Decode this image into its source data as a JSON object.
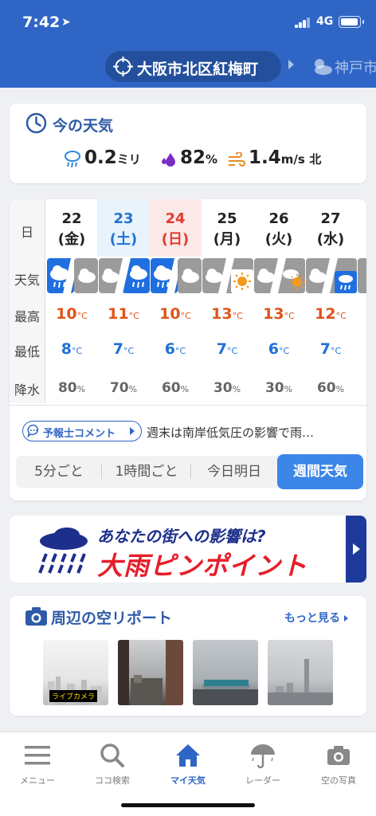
{
  "status": {
    "time": "7:42",
    "network": "4G"
  },
  "location": {
    "current": "大阪市北区紅梅町",
    "next": "神戸市"
  },
  "now": {
    "title": "今の天気",
    "precip_value": "0.2",
    "precip_unit": "ミリ",
    "humidity_value": "82",
    "humidity_unit": "%",
    "wind_value": "1.4",
    "wind_unit": "m/s",
    "wind_dir": "北"
  },
  "forecast": {
    "labels": {
      "day": "日",
      "weather": "天気",
      "max": "最高",
      "min": "最低",
      "pop": "降水"
    },
    "days": [
      {
        "num": "22",
        "wk": "(金)",
        "max": "10",
        "min": "8",
        "pop": "80",
        "icon": "rain-then-cloudy"
      },
      {
        "num": "23",
        "wk": "(土)",
        "max": "11",
        "min": "7",
        "pop": "70",
        "icon": "cloudy-then-rain"
      },
      {
        "num": "24",
        "wk": "(日)",
        "max": "10",
        "min": "6",
        "pop": "60",
        "icon": "rain-then-cloudy"
      },
      {
        "num": "25",
        "wk": "(月)",
        "max": "13",
        "min": "7",
        "pop": "30",
        "icon": "cloudy-then-sunny"
      },
      {
        "num": "26",
        "wk": "(火)",
        "max": "13",
        "min": "6",
        "pop": "30",
        "icon": "cloudy-then-sunny"
      },
      {
        "num": "27",
        "wk": "(水)",
        "max": "12",
        "min": "7",
        "pop": "60",
        "icon": "cloudy-then-rain"
      }
    ],
    "temp_unit": "°C",
    "pop_unit": "%",
    "comment_label": "予報士コメント",
    "comment_text": "週末は南岸低気圧の影響で雨…",
    "tabs": [
      "5分ごと",
      "1時間ごと",
      "今日明日",
      "週間天気"
    ]
  },
  "banner": {
    "line1": "あなたの街への影響は?",
    "line2": "大雨ピンポイント"
  },
  "sky": {
    "title": "周辺の空リポート",
    "more": "もっと見る",
    "livecam": "ライブカメラ"
  },
  "tabbar": [
    "メニュー",
    "ココ検索",
    "マイ天気",
    "レーダー",
    "空の写真"
  ],
  "colors": {
    "brand": "#2f66c6",
    "max_temp": "#e1531a",
    "min_temp": "#1f72d3",
    "saturday": "#1f72d3",
    "sunday": "#e13b2c"
  }
}
